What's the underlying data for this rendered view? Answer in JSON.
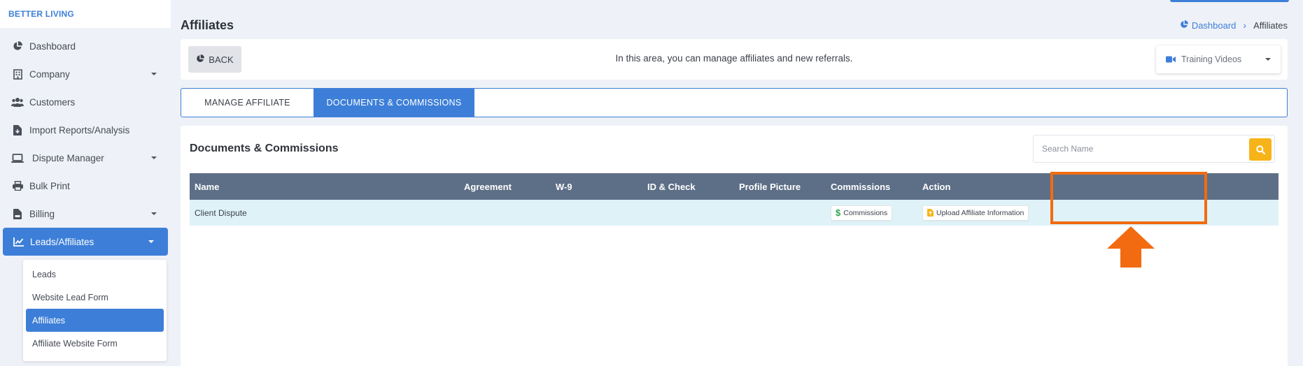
{
  "brand": "BETTER LIVING",
  "sidebar": {
    "items": [
      {
        "label": "Dashboard",
        "icon": "pie-chart-icon"
      },
      {
        "label": "Company",
        "icon": "building-icon"
      },
      {
        "label": "Customers",
        "icon": "users-icon"
      },
      {
        "label": "Import Reports/Analysis",
        "icon": "file-import-icon"
      },
      {
        "label": "Dispute Manager",
        "icon": "laptop-icon"
      },
      {
        "label": "Bulk Print",
        "icon": "printer-icon"
      },
      {
        "label": "Billing",
        "icon": "invoice-icon"
      },
      {
        "label": "Leads/Affiliates",
        "icon": "chart-line-icon"
      }
    ],
    "submenu": [
      {
        "label": "Leads"
      },
      {
        "label": "Website Lead Form"
      },
      {
        "label": "Affiliates"
      },
      {
        "label": "Affiliate Website Form"
      }
    ]
  },
  "page": {
    "title": "Affiliates",
    "breadcrumb": {
      "home": "Dashboard",
      "current": "Affiliates"
    }
  },
  "toolbar": {
    "back_label": "BACK",
    "message": "In this area, you can manage affiliates and new referrals.",
    "training_label": "Training Videos"
  },
  "tabs": [
    {
      "label": "MANAGE AFFILIATE"
    },
    {
      "label": "DOCUMENTS & COMMISSIONS"
    }
  ],
  "content": {
    "title": "Documents & Commissions",
    "search_placeholder": "Search Name"
  },
  "table": {
    "headers": [
      "Name",
      "Agreement",
      "W-9",
      "ID & Check",
      "Profile Picture",
      "Commissions",
      "Action"
    ],
    "rows": [
      {
        "name": "Client Dispute",
        "commissions_label": "Commissions",
        "action_label": "Upload Affiliate Information"
      }
    ]
  },
  "colors": {
    "accent": "#3d7fd8",
    "table_header": "#5d6f86",
    "row_highlight": "#dff2f8",
    "search_button": "#f6b419",
    "annotation": "#f26b10"
  }
}
